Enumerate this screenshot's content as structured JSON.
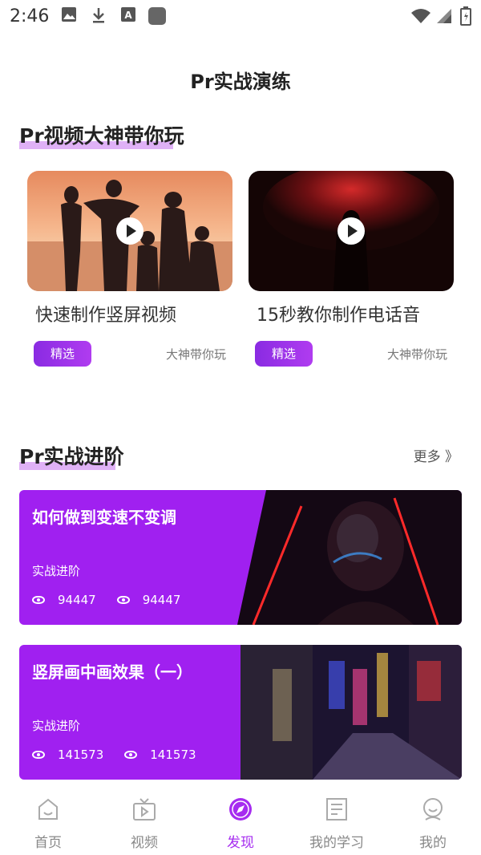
{
  "status_bar": {
    "time": "2:46"
  },
  "page_title": "Pr实战演练",
  "section1": {
    "title": "Pr视频大神带你玩",
    "cards": [
      {
        "title": "快速制作竖屏视频",
        "badge": "精选",
        "author": "大神带你玩"
      },
      {
        "title": "15秒教你制作电话音",
        "badge": "精选",
        "author": "大神带你玩"
      }
    ]
  },
  "section2": {
    "title": "Pr实战进阶",
    "more": "更多 》",
    "lessons": [
      {
        "title": "如何做到变速不变调",
        "category": "实战进阶",
        "views": "94447",
        "plays": "94447"
      },
      {
        "title": "竖屏画中画效果（一）",
        "category": "实战进阶",
        "views": "141573",
        "plays": "141573"
      }
    ]
  },
  "nav": {
    "items": [
      {
        "label": "首页",
        "icon": "home-icon"
      },
      {
        "label": "视频",
        "icon": "tv-icon"
      },
      {
        "label": "发现",
        "icon": "compass-icon"
      },
      {
        "label": "我的学习",
        "icon": "notebook-icon"
      },
      {
        "label": "我的",
        "icon": "person-icon"
      }
    ],
    "active_index": 2
  },
  "colors": {
    "accent": "#a020f0",
    "accent_text": "#a62cf0",
    "highlight": "#d9a3f5"
  }
}
